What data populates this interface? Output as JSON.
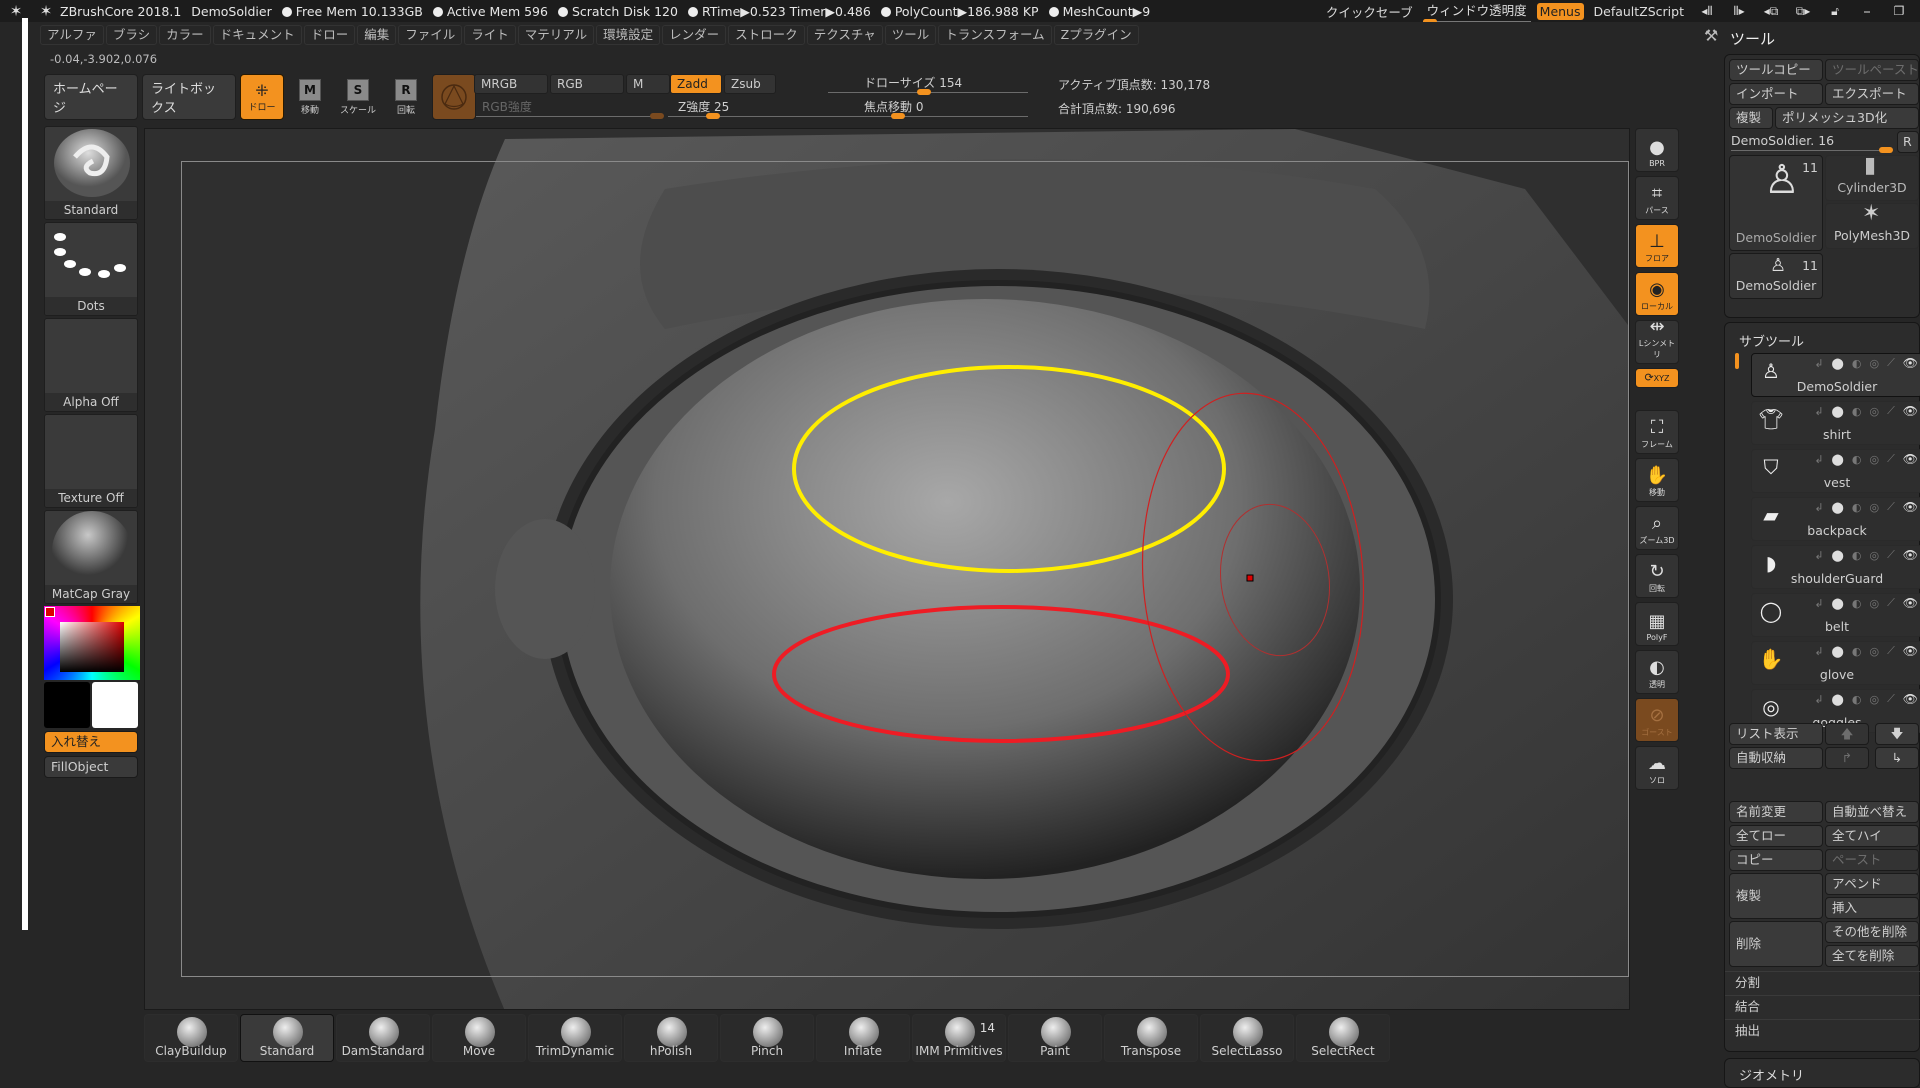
{
  "titlebar": {
    "app": "ZBrushCore 2018.1",
    "document": "DemoSoldier",
    "stats": [
      "Free Mem 10.133GB",
      "Active Mem 596",
      "Scratch Disk 120",
      "RTime▶0.523 Timer▶0.486",
      "PolyCount▶186.988 KP",
      "MeshCount▶9"
    ],
    "quicksave": "クイックセーブ",
    "window_transparency": "ウィンドウ透明度",
    "menus": "Menus",
    "script": "DefaultZScript"
  },
  "menubar": [
    "アルファ",
    "ブラシ",
    "カラー",
    "ドキュメント",
    "ドロー",
    "編集",
    "ファイル",
    "ライト",
    "マテリアル",
    "環境設定",
    "レンダー",
    "ストローク",
    "テクスチャ",
    "ツール",
    "トランスフォーム",
    "Zプラグイン"
  ],
  "coords": "-0.04,-3.902,0.076",
  "toptools": {
    "home": "ホームページ",
    "lightbox": "ライトボックス",
    "draw": "ドロー",
    "move": "移動",
    "scale": "スケール",
    "rotate": "回転",
    "mrgb": "MRGB",
    "rgb": "RGB",
    "m": "M",
    "zadd": "Zadd",
    "zsub": "Zsub",
    "rgb_intensity": "RGB強度",
    "z_intensity": "Z強度 25",
    "draw_size": "ドローサイズ 154",
    "focal_shift": "焦点移動 0",
    "active_points": "アクティブ頂点数: 130,178",
    "total_points": "合計頂点数: 190,696",
    "z_intensity_value": 25,
    "draw_size_value": 154,
    "focal_shift_value": 0
  },
  "leftcol": {
    "brush": "Standard",
    "stroke": "Dots",
    "alpha": "Alpha Off",
    "texture": "Texture Off",
    "material": "MatCap Gray",
    "swap": "入れ替え",
    "fill": "FillObject",
    "main_color": "#000000",
    "secondary_color": "#ffffff"
  },
  "rshelf": [
    {
      "icon": "bpr-icon",
      "label": "BPR",
      "state": "normal"
    },
    {
      "icon": "perspective-icon",
      "label": "パース",
      "state": "normal"
    },
    {
      "icon": "floor-icon",
      "label": "フロア",
      "state": "on"
    },
    {
      "icon": "local-icon",
      "label": "ローカル",
      "state": "on"
    },
    {
      "icon": "symmetry-icon",
      "label": "Lシンメトリ",
      "state": "normal"
    },
    {
      "icon": "xyz-icon",
      "label": "XYZ",
      "state": "on"
    },
    {
      "icon": "frame-icon",
      "label": "フレーム",
      "state": "normal"
    },
    {
      "icon": "move-icon",
      "label": "移動",
      "state": "normal"
    },
    {
      "icon": "zoom3d-icon",
      "label": "ズーム3D",
      "state": "normal"
    },
    {
      "icon": "rotate-icon",
      "label": "回転",
      "state": "normal"
    },
    {
      "icon": "polyframe-icon",
      "label": "PolyF",
      "state": "normal"
    },
    {
      "icon": "transparent-icon",
      "label": "透明",
      "state": "normal"
    },
    {
      "icon": "ghost-icon",
      "label": "ゴースト",
      "state": "dim"
    },
    {
      "icon": "solo-icon",
      "label": "ソロ",
      "state": "normal"
    }
  ],
  "toolpanel": {
    "title": "ツール",
    "copy": "ツールコピー",
    "paste": "ツールペースト",
    "import": "インポート",
    "export": "エクスポート",
    "clone": "複製",
    "make_polymesh": "ポリメッシュ3D化",
    "current_tool": "DemoSoldier. 16",
    "r": "R",
    "tools": [
      {
        "name": "DemoSoldier",
        "count": "11"
      },
      {
        "name": "Cylinder3D",
        "count": ""
      },
      {
        "name": "PolyMesh3D",
        "count": ""
      },
      {
        "name": "DemoSoldier",
        "count": "11"
      }
    ],
    "subtool_title": "サブツール",
    "subtools": [
      "DemoSoldier",
      "shirt",
      "vest",
      "backpack",
      "shoulderGuard",
      "belt",
      "glove",
      "goggles"
    ],
    "list_view": "リスト表示",
    "auto_collapse": "自動収納",
    "rename": "名前変更",
    "auto_reorder": "自動並べ替え",
    "all_low": "全てロー",
    "all_high": "全てハイ",
    "copy2": "コピー",
    "paste2": "ペースト",
    "duplicate": "複製",
    "append": "アペンド",
    "insert": "挿入",
    "delete": "削除",
    "delete_other": "その他を削除",
    "delete_all": "全てを削除",
    "split": "分割",
    "merge": "結合",
    "extract": "抽出",
    "geometry": "ジオメトリ"
  },
  "bottomshelf": [
    {
      "name": "ClayBuildup",
      "count": ""
    },
    {
      "name": "Standard",
      "count": "",
      "selected": true
    },
    {
      "name": "DamStandard",
      "count": ""
    },
    {
      "name": "Move",
      "count": ""
    },
    {
      "name": "TrimDynamic",
      "count": ""
    },
    {
      "name": "hPolish",
      "count": ""
    },
    {
      "name": "Pinch",
      "count": ""
    },
    {
      "name": "Inflate",
      "count": ""
    },
    {
      "name": "IMM Primitives",
      "count": "14"
    },
    {
      "name": "Paint",
      "count": ""
    },
    {
      "name": "Transpose",
      "count": ""
    },
    {
      "name": "SelectLasso",
      "count": ""
    },
    {
      "name": "SelectRect",
      "count": ""
    }
  ],
  "colors": {
    "accent": "#f3921f",
    "annotation_yellow": "#ffee00",
    "annotation_red": "#ee1c24"
  }
}
